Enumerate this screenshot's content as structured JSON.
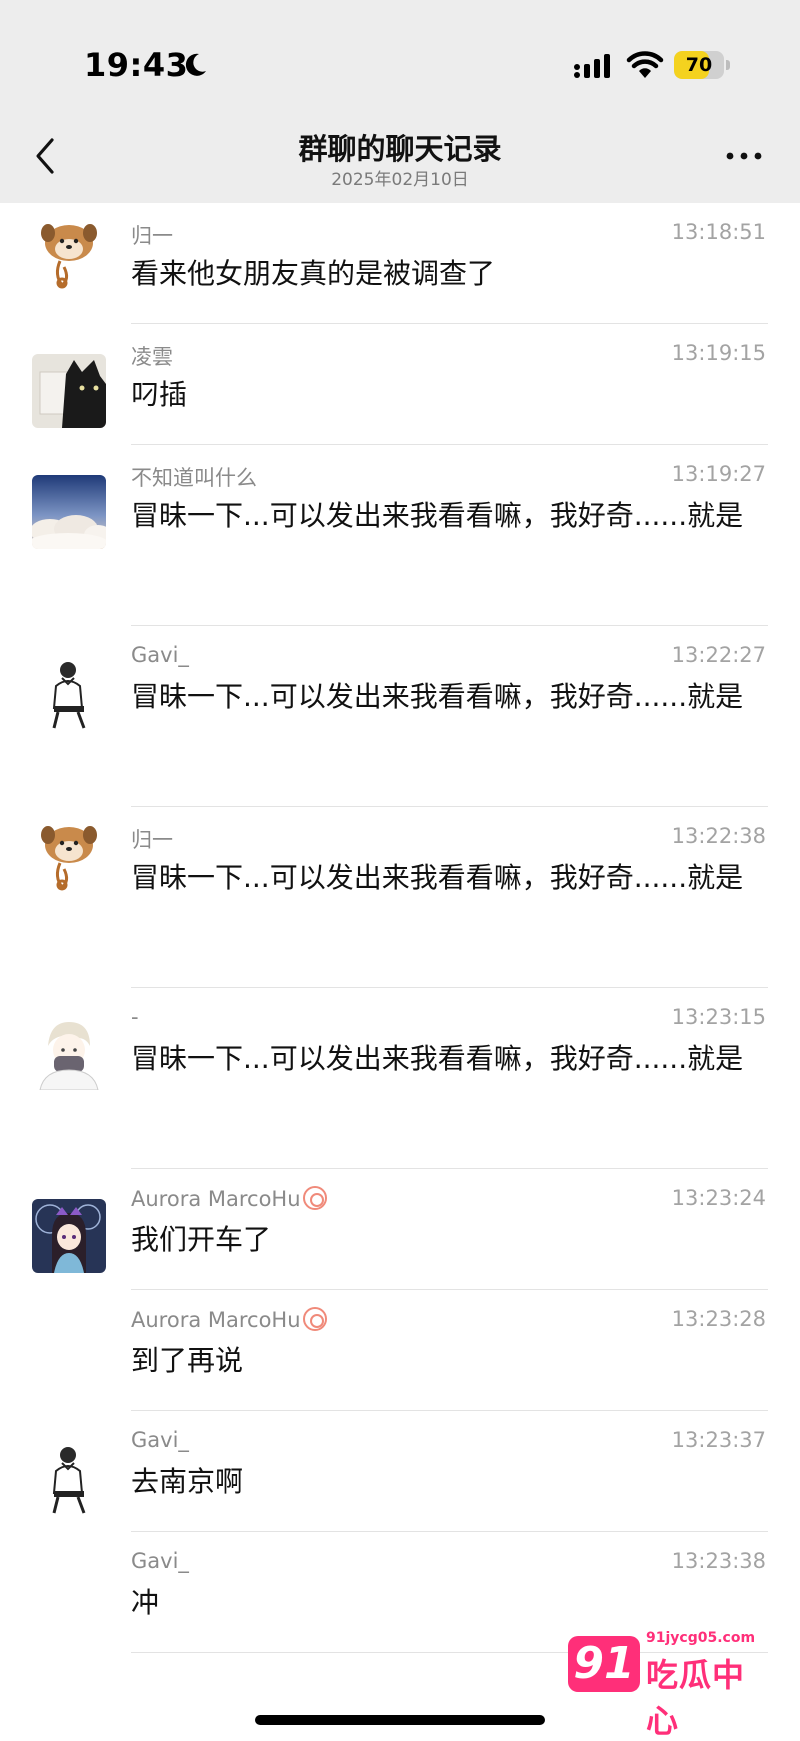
{
  "status_bar": {
    "time": "19:43",
    "battery": "70",
    "battery_level": 0.7,
    "battery_color": "#f4d21f"
  },
  "nav": {
    "title": "群聊的聊天记录",
    "date": "2025年02月10日"
  },
  "messages": [
    {
      "sender": "归一",
      "time": "13:18:51",
      "text": "看来他女朋友真的是被调查了",
      "avatar": "dog-plush-avatar",
      "badge": false
    },
    {
      "sender": "凌雲",
      "time": "13:19:15",
      "text": "叼插",
      "avatar": "black-cat-avatar",
      "badge": false
    },
    {
      "sender": "不知道叫什么",
      "time": "13:19:27",
      "text": "冒昧一下...可以发出来我看看嘛，我好奇......就是",
      "avatar": "clouds-avatar",
      "badge": false
    },
    {
      "sender": "Gavi_",
      "time": "13:22:27",
      "text": "冒昧一下...可以发出来我看看嘛，我好奇......就是",
      "avatar": "man-sketch-avatar",
      "badge": false
    },
    {
      "sender": "归一",
      "time": "13:22:38",
      "text": "冒昧一下...可以发出来我看看嘛，我好奇......就是",
      "avatar": "dog-plush-avatar",
      "badge": false
    },
    {
      "sender": "-",
      "time": "13:23:15",
      "text": "冒昧一下...可以发出来我看看嘛，我好奇......就是",
      "avatar": "anime-boy-avatar",
      "badge": false
    },
    {
      "sender": "Aurora MarcoHu",
      "time": "13:23:24",
      "text": "我们开车了",
      "avatar": "anime-girl-avatar",
      "badge": true
    },
    {
      "sender": "Aurora MarcoHu",
      "time": "13:23:28",
      "text": "到了再说",
      "avatar": "",
      "badge": true
    },
    {
      "sender": "Gavi_",
      "time": "13:23:37",
      "text": "去南京啊",
      "avatar": "man-sketch-avatar",
      "badge": false
    },
    {
      "sender": "Gavi_",
      "time": "13:23:38",
      "text": "冲",
      "avatar": "",
      "badge": false
    }
  ],
  "watermark": {
    "logo": "91",
    "url": "91jycg05.com",
    "name": "吃瓜中心",
    "color": "#ff2f79"
  }
}
